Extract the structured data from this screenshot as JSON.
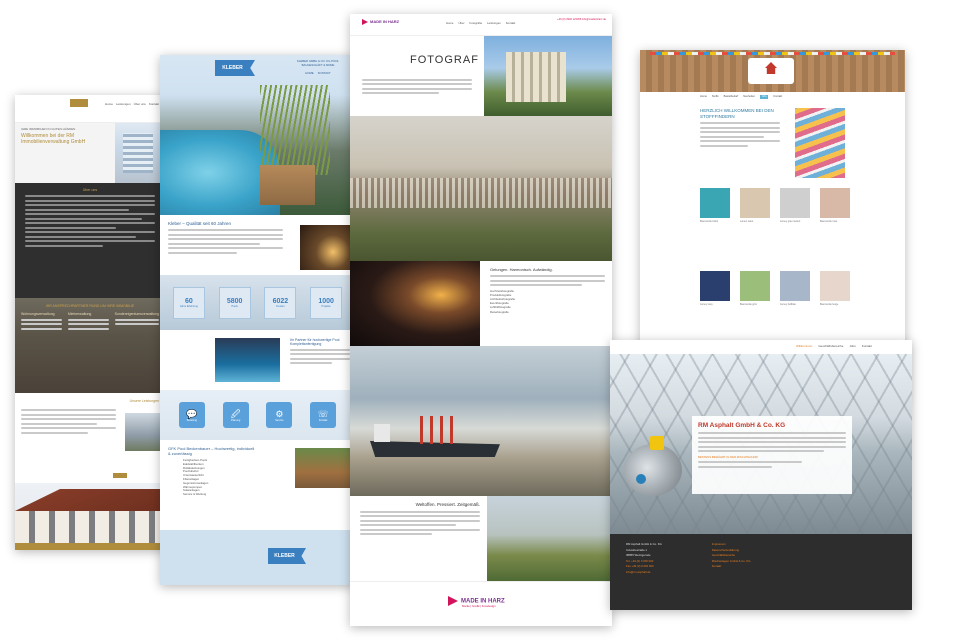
{
  "cards": {
    "immobilien": {
      "kicker": "IHRE IMMOBILIEN IN GUTEN HÄNDEN",
      "title": "Willkommen bei der RM Immobilienverwaltung GmbH",
      "nav": [
        "Home",
        "Leistungen",
        "Über uns",
        "Kontakt"
      ],
      "dark_heading": "Über uns",
      "goldstrip": "IHR ANSPRECHPARTNER RUND UM IHRE IMMOBILIE",
      "columns": [
        "Wohnungsverwaltung",
        "Mietverwaltung",
        "Sondereigentumsverwaltung"
      ],
      "section_title": "Unsere Leistungen",
      "accent": "#b08d3c"
    },
    "kleber": {
      "logo": "KLEBER",
      "header_info": "KLEBER GMBH & CO. KG POOL BAUGESCHÄFT & MORE",
      "header_links": [
        "HOME",
        "KONTAKT"
      ],
      "intro_heading": "Kleber – Qualität seit 60 Jahren",
      "stats": [
        {
          "value": "60",
          "label": "Jahre Erfahrung"
        },
        {
          "value": "5800",
          "label": "Pools"
        },
        {
          "value": "6022",
          "label": "Kunden"
        },
        {
          "value": "1000",
          "label": "Projekte"
        }
      ],
      "feature_heading": "Ihr Partner für hochwertige Pool Komplettanfertigung",
      "icons": [
        {
          "glyph": "💬",
          "label": "Beratung"
        },
        {
          "glyph": "🖉",
          "label": "Planung"
        },
        {
          "glyph": "⚙",
          "label": "Service"
        },
        {
          "glyph": "☏",
          "label": "Kontakt"
        }
      ],
      "section_heading": "GFK Pool Beckenbauer – Hochwertig, individuell & zuverlässig",
      "list": [
        "Fertigbecken-Pools",
        "Edelstahlbecken",
        "Rollabdeckungen",
        "Poolzubehör",
        "Unterwasserlicht",
        "Filteranlagen",
        "Gegenstromanlagen",
        "Wärmepumpen",
        "Solaranlagen",
        "Service & Wartung"
      ],
      "footer_logo": "KLEBER",
      "accent": "#3a7fc0"
    },
    "fotograf": {
      "brand": "MADE IN HARZ",
      "menu": [
        "Home",
        "Über",
        "Fotografie",
        "Leistungen",
        "Kontakt"
      ],
      "contact": "+49 (0) 3946 123456\ninfo@madeinharz.de",
      "hero_title": "FOTOGRAF",
      "tunnel_heading": "Gelungen. Harmonisch. Aufwändig.",
      "services": [
        "Hochzeitsfotografie",
        "Produktfotografie",
        "Architekturfotografie",
        "Eventfotografie",
        "Luftbildfotografie",
        "Reisefotografie"
      ],
      "last_heading": "Weltoffen. Pressiert. Zeitgemäß.",
      "footer_logo": "MADE IN HARZ",
      "footer_sub": "Marke | Grafik | Fotodesign",
      "accent": "#d4145a"
    },
    "stoff": {
      "nav": [
        "Home",
        "Stoffe",
        "Bastelbedarf",
        "Neuheiten",
        "Info",
        "Kontakt"
      ],
      "active_nav": "Info",
      "heading": "HERZLICH WILLKOMMEN BEI DEN STOFFFINDERN",
      "swatches": [
        {
          "color": "#3aa6b3",
          "label": "Baumwolle türkis"
        },
        {
          "color": "#d9c7b0",
          "label": "Leinen natur"
        },
        {
          "color": "#cfcfcf",
          "label": "Jersey grau meliert"
        },
        {
          "color": "#d8b9a8",
          "label": "Baumwolle rosa"
        },
        {
          "color": "#2b3f6e",
          "label": "Jersey navy"
        },
        {
          "color": "#9bbf7a",
          "label": "Baumwolle grün"
        },
        {
          "color": "#a7b7c9",
          "label": "Jersey hellblau"
        },
        {
          "color": "#e7d6cc",
          "label": "Baumwolle beige"
        }
      ],
      "accent": "#5bb3d6"
    },
    "asphalt": {
      "nav": [
        "Willkommen",
        "Geschäftsbereiche",
        "Jobs",
        "Kontakt"
      ],
      "active_nav": "Willkommen",
      "title": "RM Asphalt GmbH & Co. KG",
      "highlight": "BESTENS BEWÄHRT IN DER MISCHTECHNIK",
      "footer_col1": [
        "RM Asphalt GmbH & Co. KG",
        "Industriestraße 1",
        "38855 Wernigerode",
        "Tel. +49 (0) 0 000 000",
        "Fax +49 (0) 0 000 000",
        "info@rm-asphalt.de"
      ],
      "footer_col2": [
        "Impressum",
        "Datenschutzerklärung",
        "Geschäftsbereiche",
        "Mischanlagen GmbH & Co. KG",
        "Kontakt"
      ],
      "accent": "#e67e22",
      "title_color": "#c0392b"
    }
  }
}
